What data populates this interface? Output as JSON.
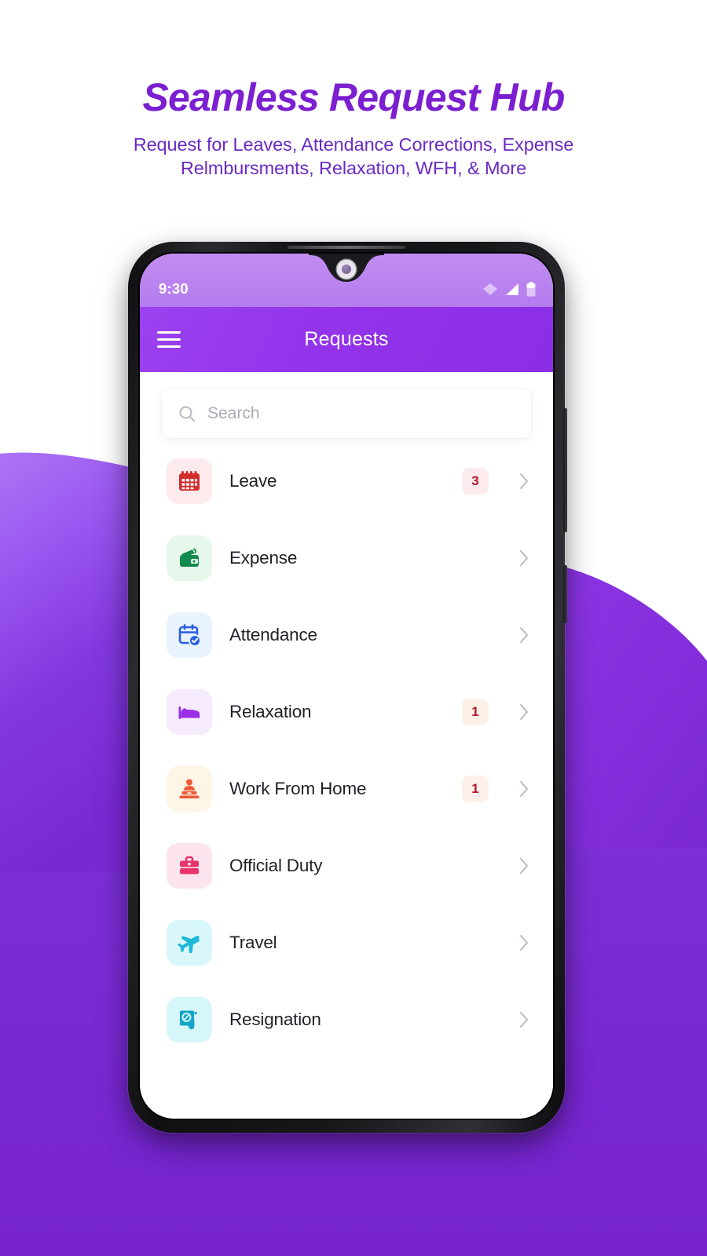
{
  "hero": {
    "title": "Seamless Request Hub",
    "subtitle_line1": "Request for Leaves, Attendance Corrections, Expense",
    "subtitle_line2": "Relmbursments, Relaxation, WFH, & More",
    "title_color": "#7B1FD0",
    "subtitle_color": "#6B2BC4"
  },
  "background": {
    "purple_light": "#A86CF3",
    "purple_deep": "#7C2FD6",
    "page_bg": "#FFFFFF"
  },
  "phone": {
    "statusbar": {
      "time": "9:30",
      "icons": [
        "wifi-icon",
        "signal-icon",
        "battery-icon"
      ],
      "bg_color": "#B47CEF"
    },
    "appbar": {
      "menu_icon": "hamburger-menu-icon",
      "title": "Requests",
      "bg_color": "#9333EA"
    },
    "search": {
      "icon": "search-icon",
      "placeholder": "Search",
      "value": ""
    },
    "list": [
      {
        "label": "Leave",
        "icon": "calendar-icon",
        "icon_color": "#D32F2F",
        "tile_color": "#FDEAEC",
        "badge": "3",
        "badge_bg": "#FCEBED",
        "badge_color": "#B2182B"
      },
      {
        "label": "Expense",
        "icon": "wallet-icon",
        "icon_color": "#128A4D",
        "tile_color": "#E6F8EC",
        "badge": "",
        "badge_bg": "",
        "badge_color": ""
      },
      {
        "label": "Attendance",
        "icon": "calendar-check-icon",
        "icon_color": "#2A5FE0",
        "tile_color": "#E8F3FE",
        "badge": "",
        "badge_bg": "",
        "badge_color": ""
      },
      {
        "label": "Relaxation",
        "icon": "bed-icon",
        "icon_color": "#9B2FE8",
        "tile_color": "#F6EAFD",
        "badge": "1",
        "badge_bg": "#FDF1E7",
        "badge_color": "#B2182B"
      },
      {
        "label": "Work From Home",
        "icon": "work-from-home-icon",
        "icon_color": "#EE5B38",
        "tile_color": "#FDF6E6",
        "badge": "1",
        "badge_bg": "#FDF0EA",
        "badge_color": "#B2182B"
      },
      {
        "label": "Official Duty",
        "icon": "briefcase-icon",
        "icon_color": "#E8336B",
        "tile_color": "#FCE4EE",
        "badge": "",
        "badge_bg": "",
        "badge_color": ""
      },
      {
        "label": "Travel",
        "icon": "airplane-icon",
        "icon_color": "#1EB8D8",
        "tile_color": "#D9F7FB",
        "badge": "",
        "badge_bg": "",
        "badge_color": ""
      },
      {
        "label": "Resignation",
        "icon": "resignation-document-icon",
        "icon_color": "#12A5C9",
        "tile_color": "#D6F6FA",
        "badge": "",
        "badge_bg": "",
        "badge_color": ""
      }
    ]
  }
}
